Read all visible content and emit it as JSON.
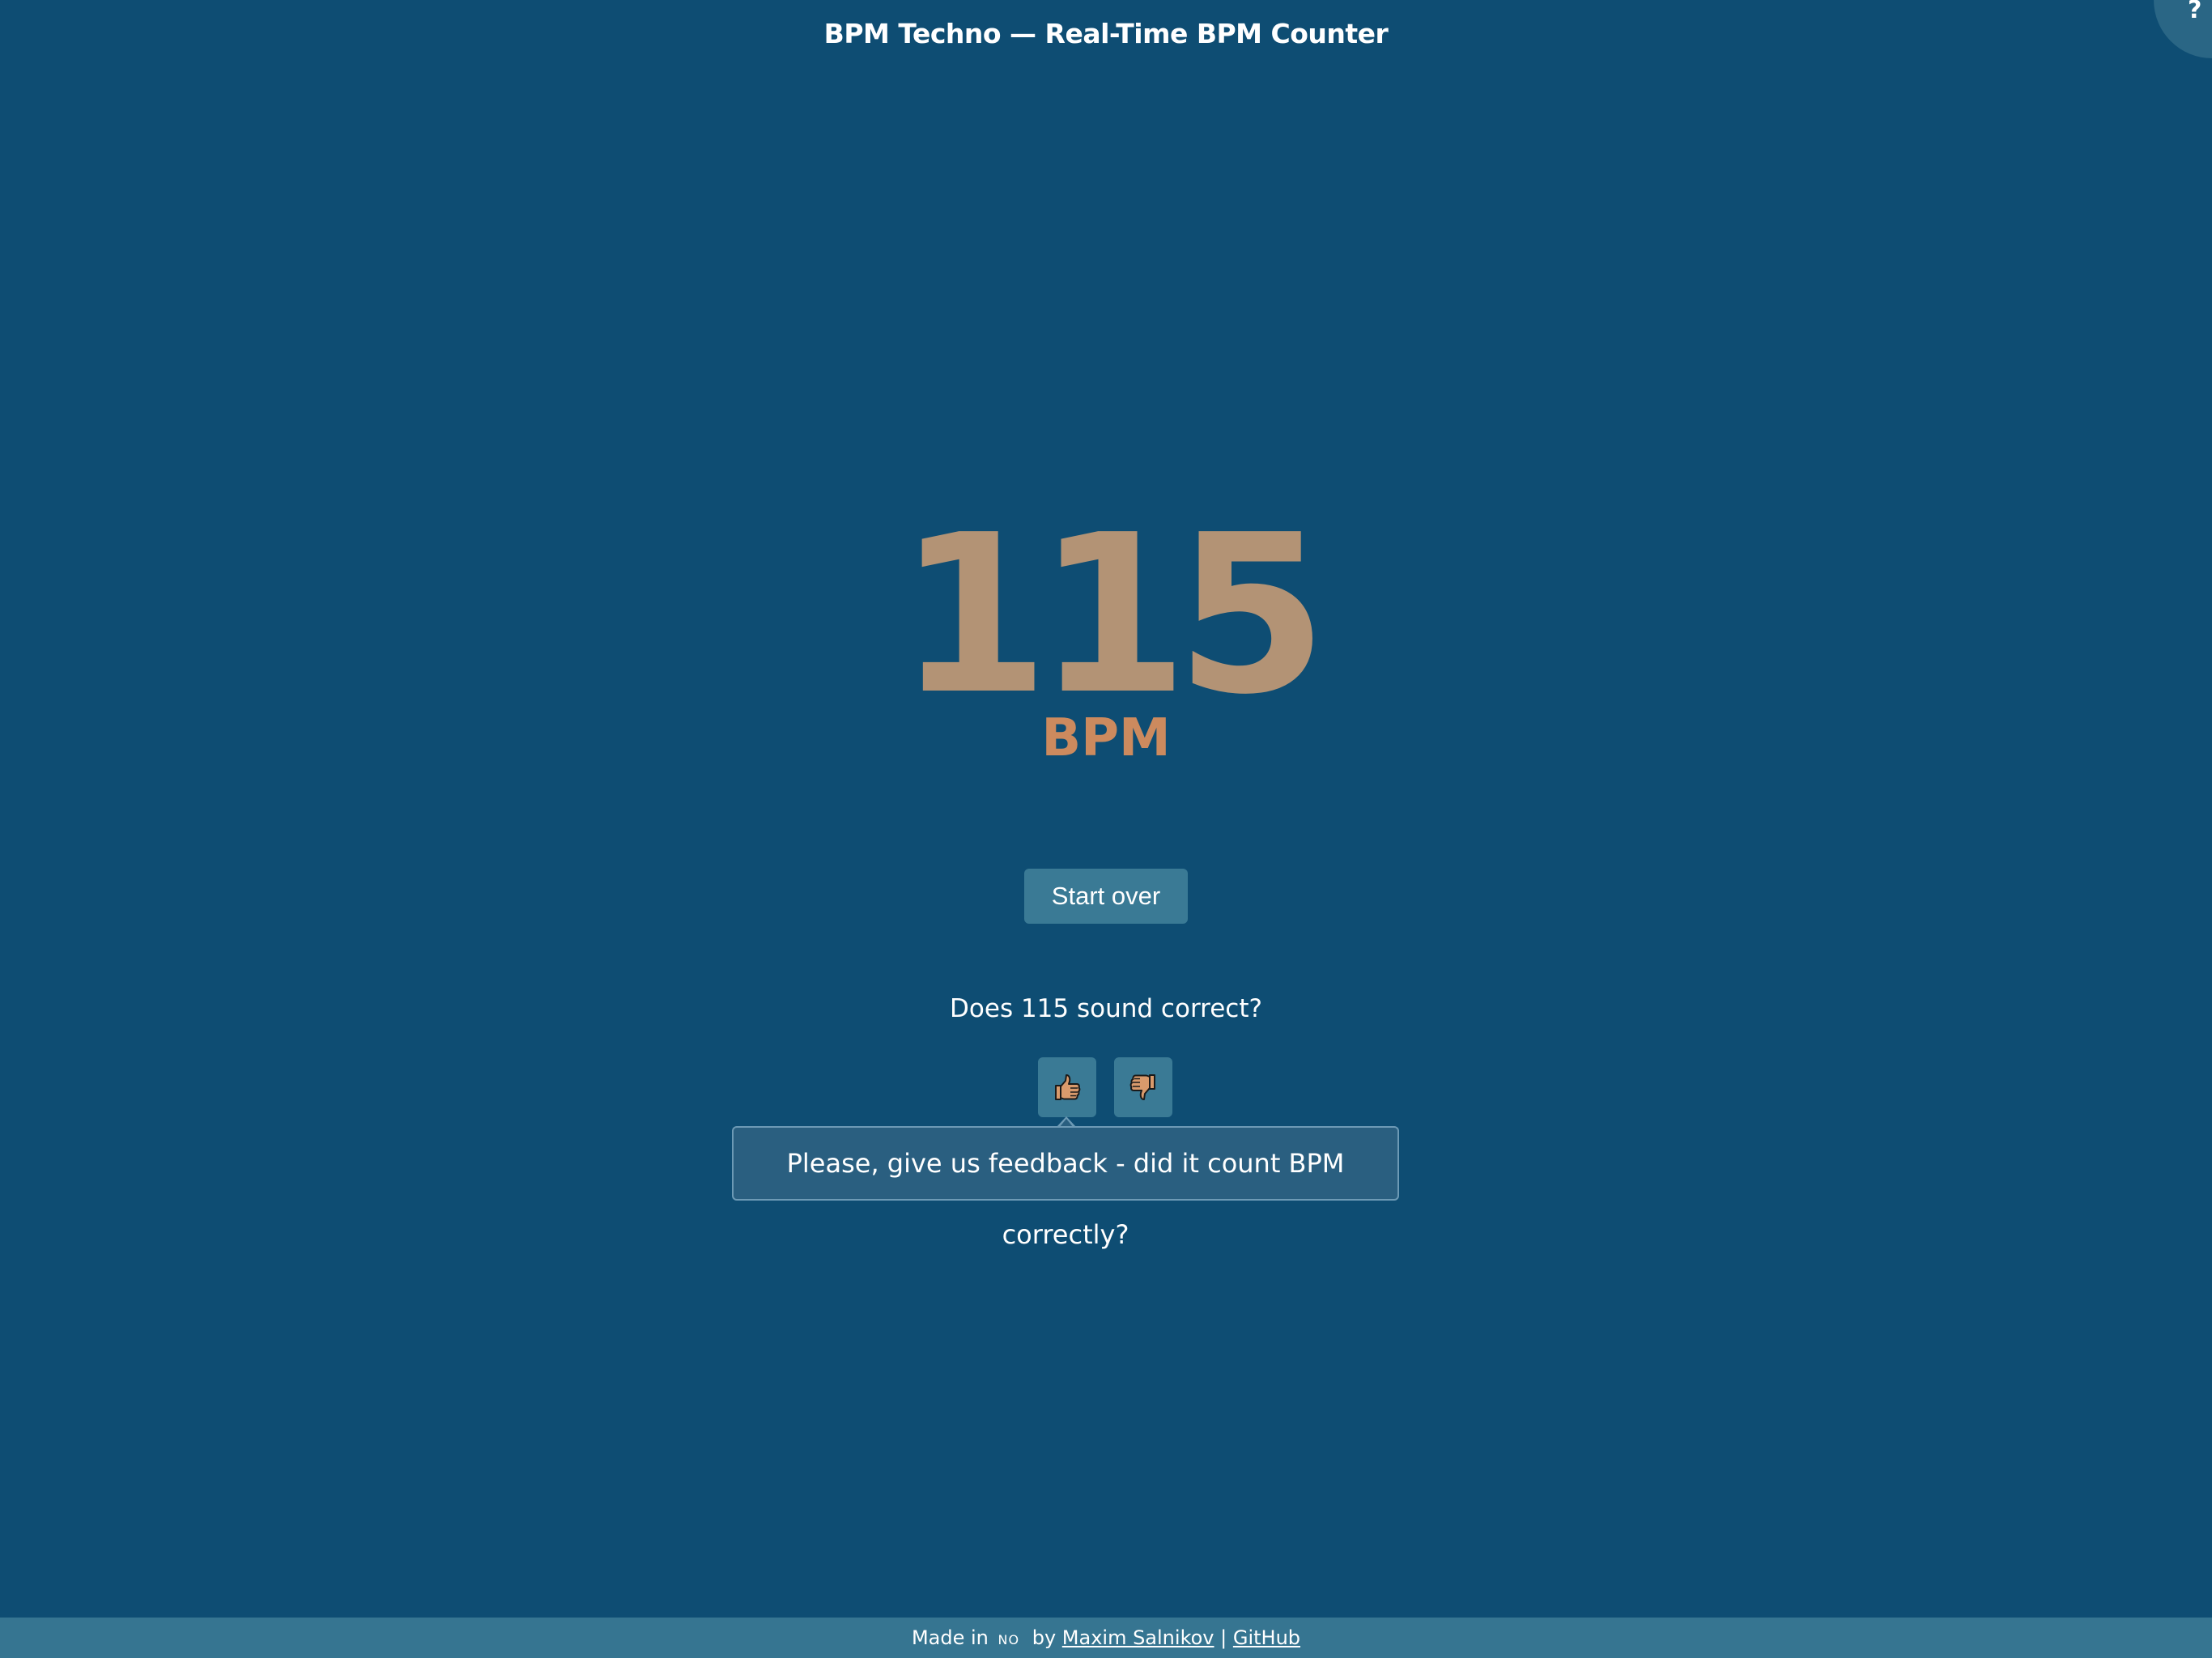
{
  "header": {
    "title": "BPM Techno — Real-Time BPM Counter",
    "help_label": "?"
  },
  "result": {
    "bpm_value": "115",
    "bpm_unit": "BPM"
  },
  "actions": {
    "start_over_label": "Start over"
  },
  "feedback": {
    "question": "Does 115 sound correct?",
    "thumbs_up_icon": "thumbs-up-icon",
    "thumbs_down_icon": "thumbs-down-icon",
    "tooltip": "Please, give us feedback - did it count BPM correctly?"
  },
  "footer": {
    "made_in": "Made in",
    "flag_code": "NO",
    "by": "by",
    "author_link": "Maxim Salnikov",
    "separator": "|",
    "github_link": "GitHub"
  },
  "colors": {
    "background": "#0e4d73",
    "bpm_value": "#b39375",
    "bpm_unit": "#cc8a5e",
    "button": "#3a7a95",
    "icon_fill": "#d99a6c"
  }
}
